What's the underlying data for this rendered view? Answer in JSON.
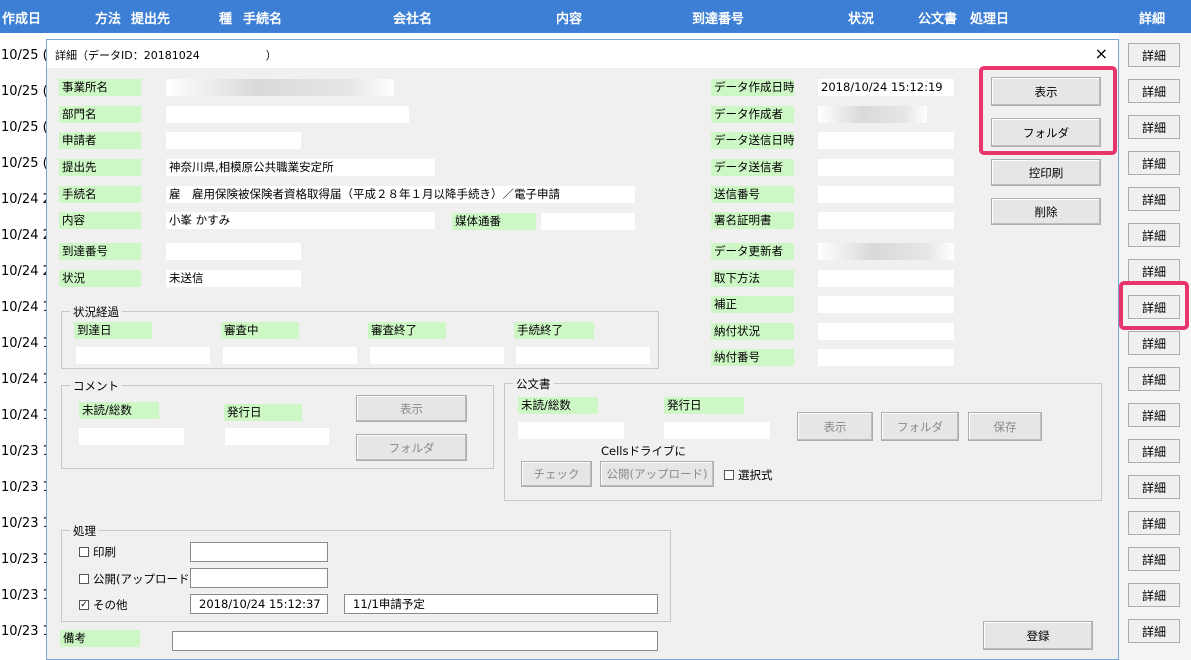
{
  "header": {
    "cols": [
      "作成日",
      "方法",
      "提出先",
      "種",
      "手続名",
      "会社名",
      "内容",
      "到達番号",
      "状況",
      "公文書",
      "処理日",
      "詳細"
    ]
  },
  "rows": [
    {
      "date": "10/25 (",
      "detail": "詳細"
    },
    {
      "date": "10/25 (",
      "detail": "詳細"
    },
    {
      "date": "10/25 (",
      "detail": "詳細"
    },
    {
      "date": "10/25 (",
      "detail": "詳細"
    },
    {
      "date": "10/24 2",
      "detail": "詳細"
    },
    {
      "date": "10/24 2",
      "detail": "詳細"
    },
    {
      "date": "10/24 2",
      "detail": "詳細"
    },
    {
      "date": "10/24 1",
      "detail": "詳細"
    },
    {
      "date": "10/24 1",
      "detail": "詳細"
    },
    {
      "date": "10/24 1",
      "detail": "詳細"
    },
    {
      "date": "10/24 1",
      "detail": "詳細"
    },
    {
      "date": "10/23 1",
      "detail": "詳細"
    },
    {
      "date": "10/23 1",
      "detail": "詳細"
    },
    {
      "date": "10/23 1",
      "detail": "詳細"
    },
    {
      "date": "10/23 1",
      "detail": "詳細"
    },
    {
      "date": "10/23 1",
      "detail": "詳細"
    },
    {
      "date": "10/23 1",
      "detail": "詳細"
    }
  ],
  "dialog": {
    "title": "詳細（データID：20181024　　　　　　）",
    "close": "×",
    "left": {
      "office_label": "事業所名",
      "dept_label": "部門名",
      "applicant_label": "申請者",
      "submit_to_label": "提出先",
      "submit_to_value": "神奈川県,相模原公共職業安定所",
      "proc_label": "手続名",
      "proc_value": "雇　雇用保険被保険者資格取得届（平成２８年１月以降手続き）／電子申請",
      "content_label": "内容",
      "content_value": "小峯 かすみ",
      "media_label": "媒体通番",
      "arrival_label": "到達番号",
      "status_label": "状況",
      "status_value": "未送信"
    },
    "progress": {
      "title": "状況経過",
      "cols": [
        "到達日",
        "審査中",
        "審査終了",
        "手続終了"
      ]
    },
    "comment": {
      "title": "コメント",
      "unread_label": "未読/総数",
      "issue_label": "発行日",
      "show": "表示",
      "folder": "フォルダ"
    },
    "official": {
      "title": "公文書",
      "unread_label": "未読/総数",
      "issue_label": "発行日",
      "show": "表示",
      "folder": "フォルダ",
      "save": "保存",
      "cells_label": "Cellsドライブに",
      "check": "チェック",
      "publish": "公開(アップロード)",
      "select": "選択式"
    },
    "processing": {
      "title": "処理",
      "print": "印刷",
      "publish": "公開(アップロード)",
      "other": "その他",
      "other_date": "2018/10/24 15:12:37",
      "other_note": "11/1申請予定",
      "check_mark": "✓"
    },
    "remarks_label": "備考",
    "register": "登録",
    "right": {
      "created_label": "データ作成日時",
      "created_value": "2018/10/24 15:12:19",
      "creator_label": "データ作成者",
      "sent_time_label": "データ送信日時",
      "sender_label": "データ送信者",
      "send_no_label": "送信番号",
      "cert_label": "署名証明書",
      "updater_label": "データ更新者",
      "withdraw_label": "取下方法",
      "correction_label": "補正",
      "payment_status_label": "納付状況",
      "payment_no_label": "納付番号"
    },
    "buttons": {
      "show": "表示",
      "folder": "フォルダ",
      "copy_print": "控印刷",
      "delete": "削除"
    }
  }
}
